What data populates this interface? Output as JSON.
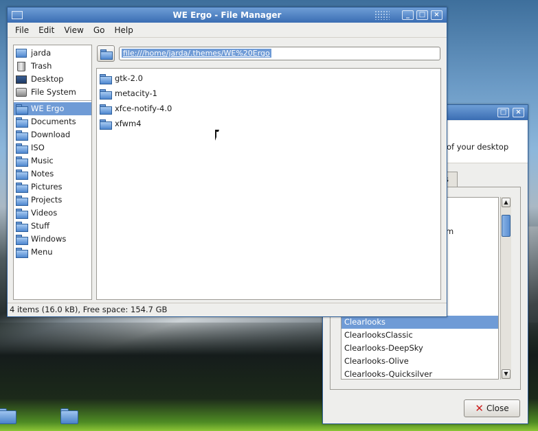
{
  "file_manager": {
    "title": "WE Ergo - File Manager",
    "menu": [
      "File",
      "Edit",
      "View",
      "Go",
      "Help"
    ],
    "location": "file:///home/jarda/.themes/WE%20Ergo",
    "places": [
      "jarda",
      "Trash",
      "Desktop",
      "File System"
    ],
    "bookmarks": [
      "WE Ergo",
      "Documents",
      "Download",
      "ISO",
      "Music",
      "Notes",
      "Pictures",
      "Projects",
      "Videos",
      "Stuff",
      "Windows",
      "Menu"
    ],
    "selected_bookmark": "WE Ergo",
    "files": [
      "gtk-2.0",
      "metacity-1",
      "xfce-notify-4.0",
      "xfwm4"
    ],
    "status": "4 items (16.0 kB), Free space: 154.7 GB"
  },
  "appearance": {
    "description_fragment": "of your desktop",
    "tab_fragment": "s",
    "list_fragment": "m",
    "themes": [
      "Clearlooks",
      "ClearlooksClassic",
      "Clearlooks-DeepSky",
      "Clearlooks-Olive",
      "Clearlooks-Quicksilver"
    ],
    "selected_theme": "Clearlooks",
    "close_label": "Close"
  },
  "window_buttons": {
    "minimize": "_",
    "maximize": "□",
    "close": "×"
  }
}
